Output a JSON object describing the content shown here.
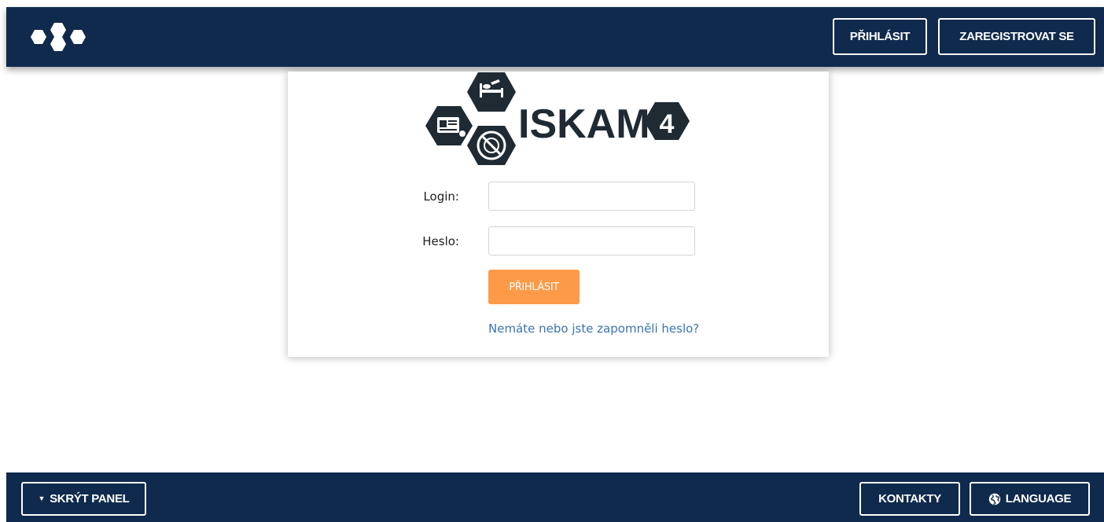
{
  "header": {
    "login_label": "PŘIHLÁSIT",
    "register_label": "ZAREGISTROVAT SE",
    "brand_icon": "hexagon-cluster-icon"
  },
  "logo": {
    "text": "ISKAM",
    "version": "4",
    "icons": [
      "id-card-icon",
      "bed-icon",
      "plate-icon"
    ]
  },
  "login_form": {
    "login_label": "Login:",
    "login_value": "",
    "password_label": "Heslo:",
    "password_value": "",
    "submit_label": "PŘIHLÁSIT",
    "forgot_link": "Nemáte nebo jste zapomněli heslo?"
  },
  "footer": {
    "hide_panel_label": "SKRÝT PANEL",
    "hide_panel_icon": "caret-down-icon",
    "contacts_label": "KONTAKTY",
    "language_label": "LANGUAGE",
    "language_icon": "globe-icon"
  },
  "colors": {
    "navy": "#0f2a4d",
    "accent_orange": "#fc9a47",
    "link_blue": "#3a73b5",
    "logo_dark": "#1f2a33"
  }
}
